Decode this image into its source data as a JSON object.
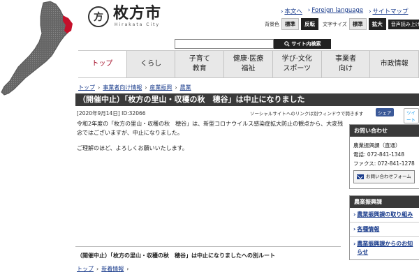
{
  "header": {
    "logo_mark": "方",
    "logo_name": "枚方市",
    "logo_sub": "Hirakata City",
    "links": [
      "本文へ",
      "Foreign language",
      "サイトマップ"
    ],
    "bg_label": "背景色",
    "bg_standard": "標準",
    "bg_inverse": "反転",
    "size_label": "文字サイズ",
    "size_standard": "標準",
    "size_large": "拡大",
    "voice": "音声読み上げ",
    "search_placeholder": "",
    "search_button": "サイト内検索"
  },
  "nav": {
    "items": [
      "トップ",
      "くらし",
      "子育て\n教育",
      "健康·医療\n福祉",
      "学び·文化\nスポーツ",
      "事業者\n向け",
      "市政情報"
    ]
  },
  "breadcrumb": {
    "items": [
      "トップ",
      "事業者向け情報",
      "産業振興",
      "農業"
    ]
  },
  "page": {
    "title": "（開催中止）「枚方の里山・収穫の秋　穂谷」は中止になりました",
    "meta": "[2020年9月14日]  ID:32066",
    "social_note": "ソーシャルサイトへのリンクは別ウィンドウで開きます",
    "share_fb": "シェア",
    "share_tw": "ツイート",
    "paragraphs": [
      "令和2年度の「枚方の里山・収穫の秋　穂谷」は、新型コロナウイルス感染症拡大防止の観点から、大変残念ではございますが、中止になりました。",
      "ご理解のほど、よろしくお願いいたします。"
    ]
  },
  "sidebar": {
    "inquiry_head": "お問い合わせ",
    "dept": "農業振興課（直通）",
    "tel": "電話: 072-841-1348",
    "fax": "ファクス: 072-841-1278",
    "form_button": "お問い合わせフォーム",
    "section_head": "農業振興課",
    "links": [
      "農業振興課の取り組み",
      "各種情報",
      "農業振興課からのお知らせ"
    ]
  },
  "footer": {
    "alt_route": "（開催中止）「枚方の里山・収穫の秋　穂谷」は中止になりましたへの別ルート",
    "breadcrumb": [
      "トップ",
      "新着情報"
    ]
  },
  "colors": {
    "accent": "#a5102a",
    "link": "#1a3c8c",
    "title_bg": "#3a3a3a",
    "map_gray": "#6b6b6b",
    "map_highlight": "#c4102a"
  }
}
